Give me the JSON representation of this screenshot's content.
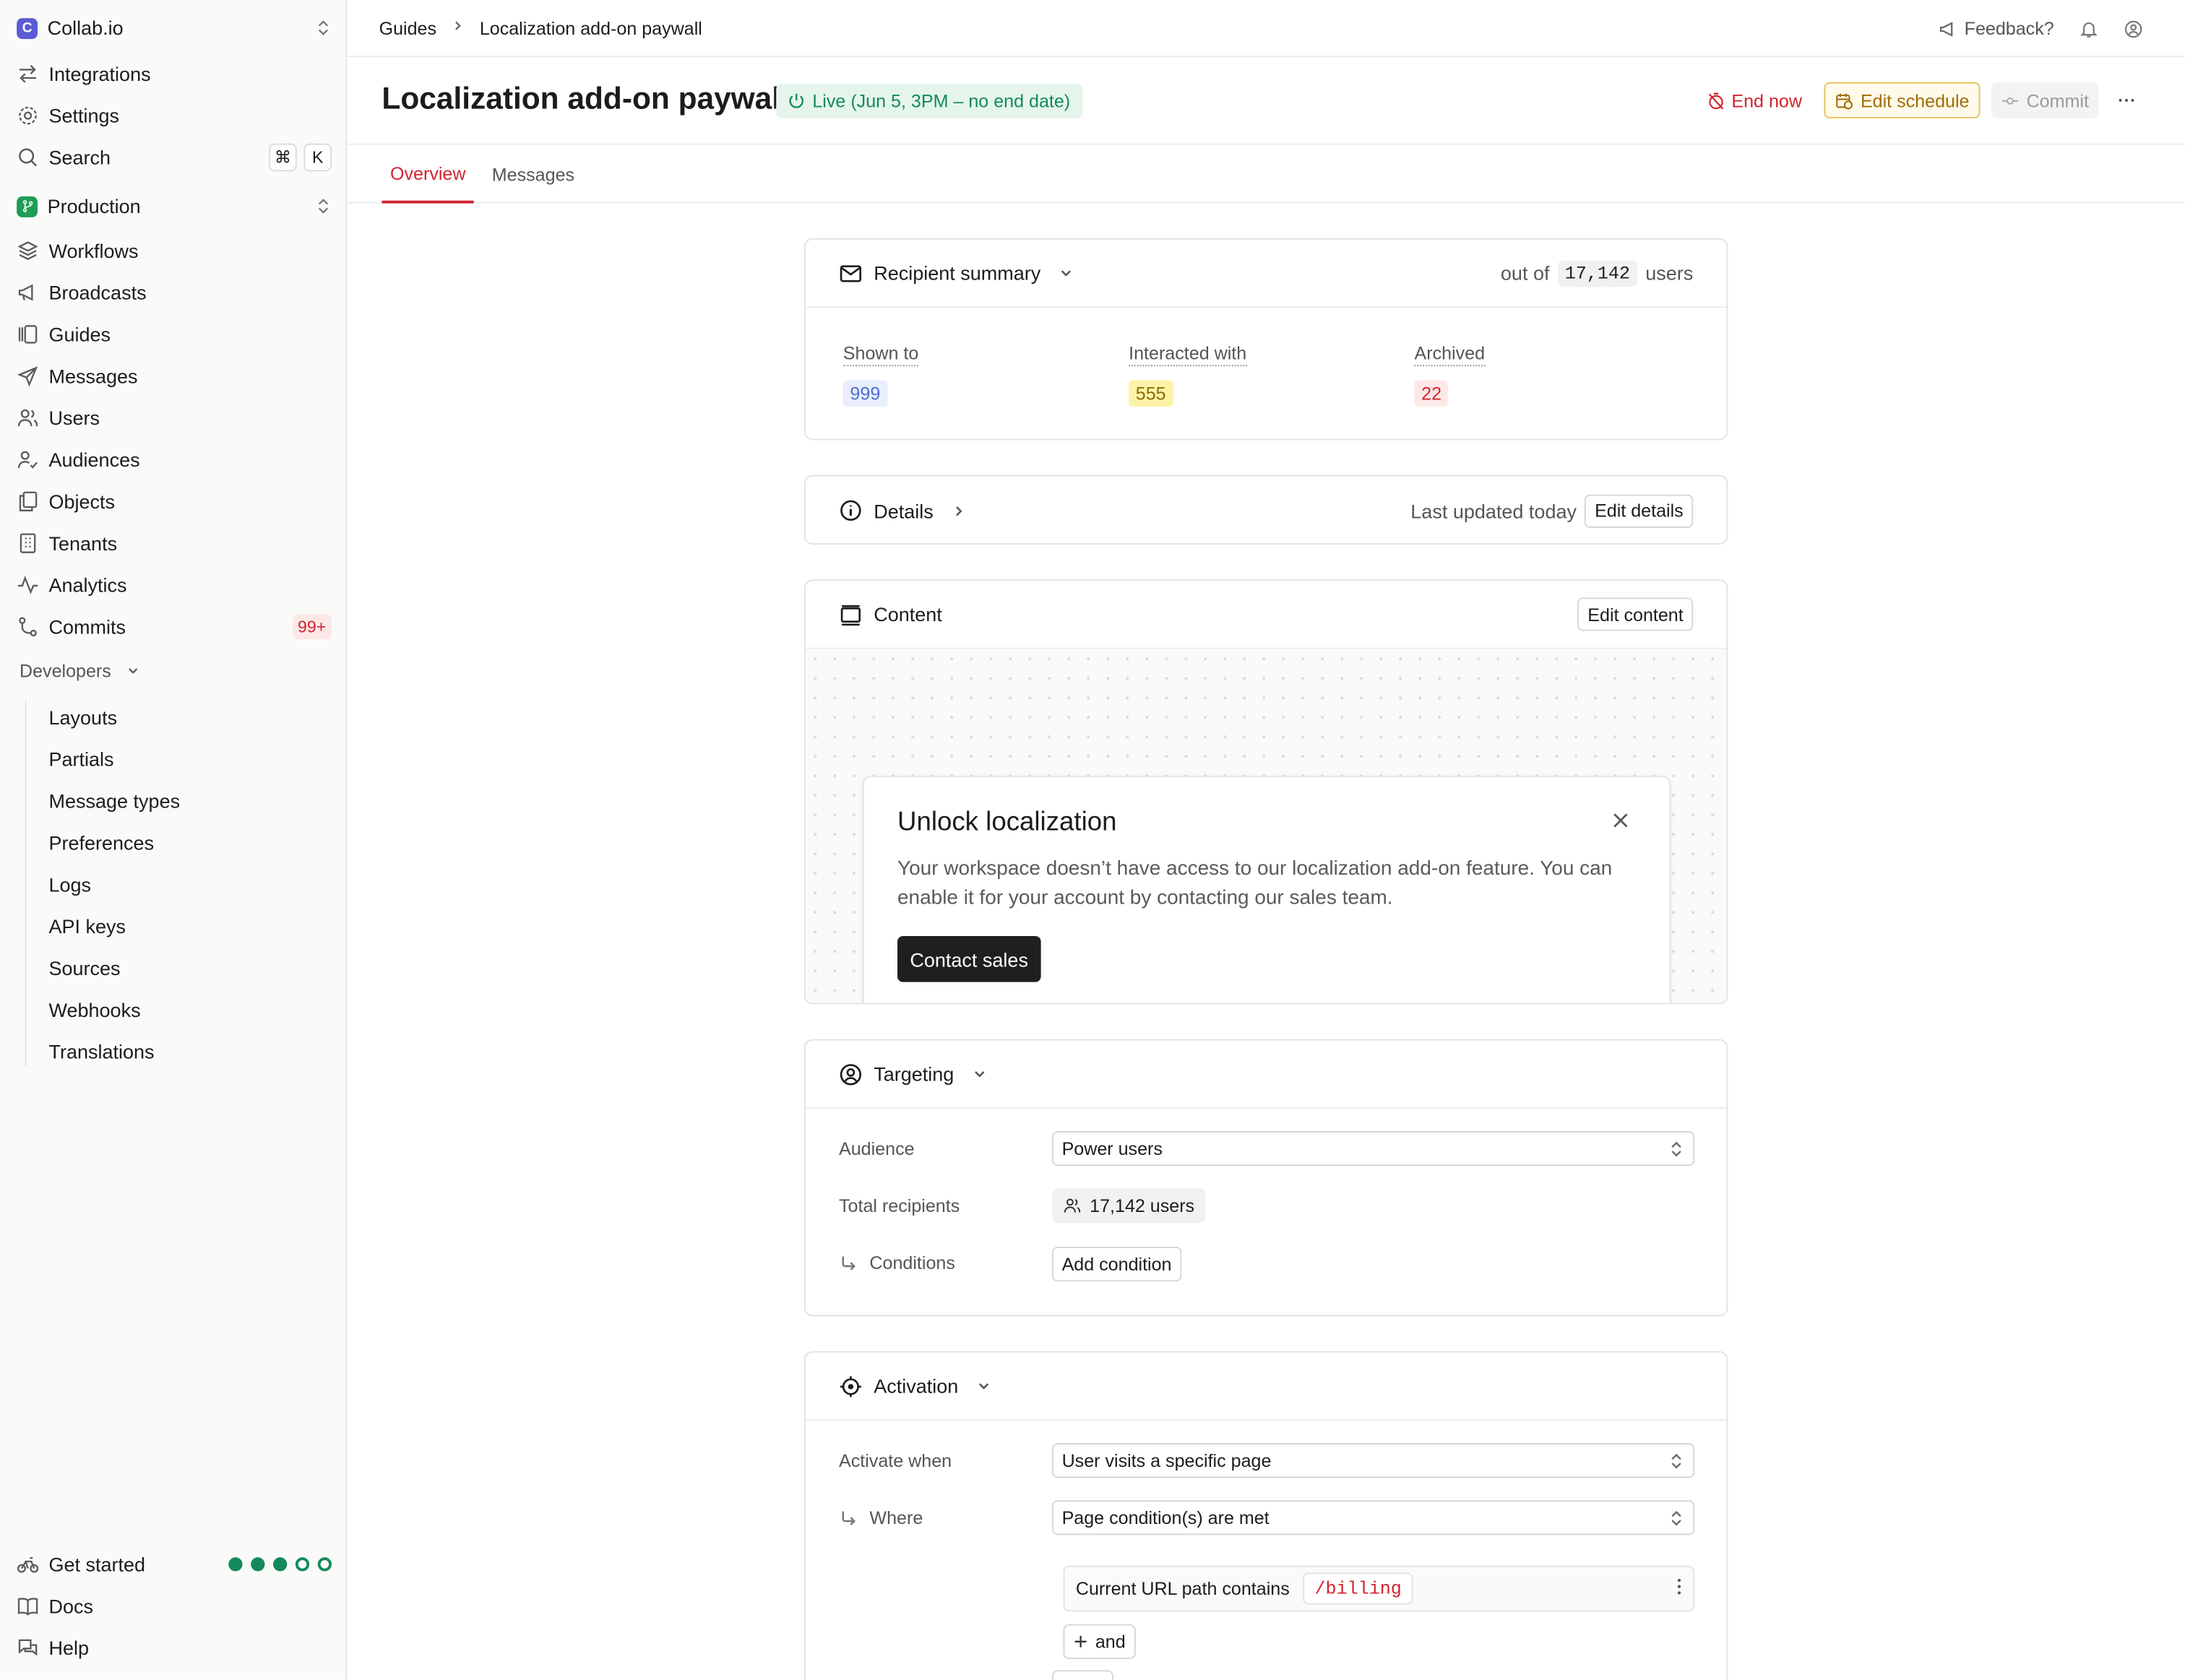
{
  "sidebar": {
    "workspace": "Collab.io",
    "workspace_initial": "C",
    "top_items": [
      {
        "label": "Integrations",
        "icon": "arrows-exchange-icon"
      },
      {
        "label": "Settings",
        "icon": "gear-icon"
      },
      {
        "label": "Search",
        "icon": "search-icon"
      }
    ],
    "search_keys": [
      "⌘",
      "K"
    ],
    "environment": "Production",
    "nav_items": [
      {
        "label": "Workflows",
        "icon": "layers-icon"
      },
      {
        "label": "Broadcasts",
        "icon": "megaphone-icon"
      },
      {
        "label": "Guides",
        "icon": "guides-icon"
      },
      {
        "label": "Messages",
        "icon": "send-icon"
      },
      {
        "label": "Users",
        "icon": "users-icon"
      },
      {
        "label": "Audiences",
        "icon": "audience-icon"
      },
      {
        "label": "Objects",
        "icon": "objects-icon"
      },
      {
        "label": "Tenants",
        "icon": "building-icon"
      },
      {
        "label": "Analytics",
        "icon": "activity-icon"
      },
      {
        "label": "Commits",
        "icon": "git-commit-icon"
      }
    ],
    "commits_badge": "99+",
    "developers_label": "Developers",
    "developer_items": [
      "Layouts",
      "Partials",
      "Message types",
      "Preferences",
      "Logs",
      "API keys",
      "Sources",
      "Webhooks",
      "Translations"
    ],
    "footer_items": [
      {
        "label": "Get started",
        "icon": "bike-icon"
      },
      {
        "label": "Docs",
        "icon": "book-icon"
      },
      {
        "label": "Help",
        "icon": "help-chat-icon"
      }
    ],
    "get_started_progress": {
      "completed": 3,
      "total": 5
    }
  },
  "topbar": {
    "breadcrumb": [
      "Guides",
      "Localization add-on paywall"
    ],
    "feedback": "Feedback?"
  },
  "header": {
    "title": "Localization add-on paywall",
    "status": "Live (Jun 5, 3PM – no end date)",
    "end_now": "End now",
    "edit_schedule": "Edit schedule",
    "commit": "Commit"
  },
  "tabs": [
    {
      "label": "Overview",
      "active": true
    },
    {
      "label": "Messages",
      "active": false
    }
  ],
  "recipient_summary": {
    "title": "Recipient summary",
    "out_of_prefix": "out of",
    "total": "17,142",
    "out_of_suffix": "users",
    "stats": [
      {
        "label": "Shown to",
        "value": "999",
        "color": "#4f6fd1",
        "bg": "#e8eefc"
      },
      {
        "label": "Interacted with",
        "value": "555",
        "color": "#8a6d00",
        "bg": "#fdf3a8"
      },
      {
        "label": "Archived",
        "value": "22",
        "color": "#d1242f",
        "bg": "#fde8e8"
      }
    ]
  },
  "details": {
    "title": "Details",
    "last_updated": "Last updated today",
    "edit": "Edit details"
  },
  "content": {
    "title": "Content",
    "edit": "Edit content",
    "preview": {
      "title": "Unlock localization",
      "body": "Your workspace doesn’t have access to our localization add-on feature. You can enable it for your account by contacting our sales team.",
      "cta": "Contact sales"
    }
  },
  "targeting": {
    "title": "Targeting",
    "audience_label": "Audience",
    "audience_value": "Power users",
    "total_label": "Total recipients",
    "total_value": "17,142 users",
    "conditions_label": "Conditions",
    "add_condition": "Add condition"
  },
  "activation": {
    "title": "Activation",
    "activate_label": "Activate when",
    "activate_value": "User visits a specific page",
    "where_label": "Where",
    "where_value": "Page condition(s) are met",
    "condition_text": "Current URL path contains",
    "condition_value": "/billing",
    "and_label": "and"
  },
  "colors": {
    "accent_red": "#d1242f",
    "live_green": "#138a5b",
    "schedule_amber": "#a26b00"
  }
}
